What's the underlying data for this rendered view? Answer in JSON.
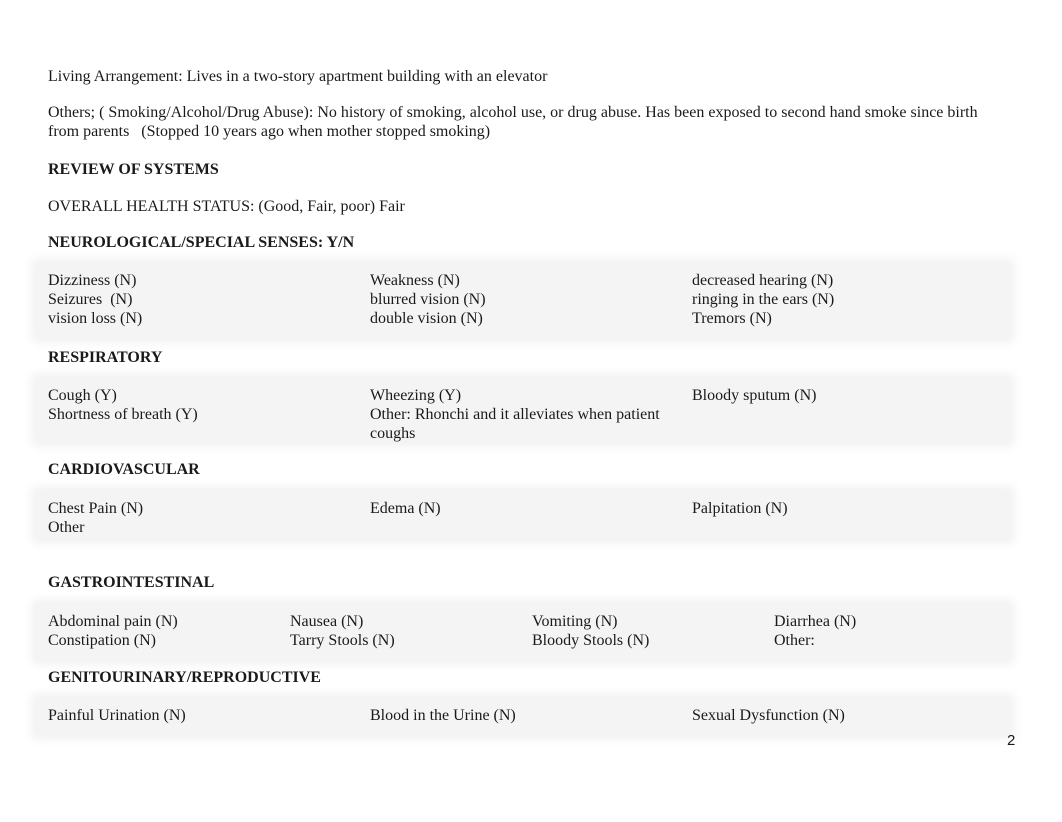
{
  "living_arrangement": "Living Arrangement: Lives in a two-story apartment building with an elevator",
  "others_line1": "Others; ( Smoking/Alcohol/Drug Abuse): No history of smoking, alcohol use, or drug abuse. Has been exposed to second hand smoke since birth",
  "others_line2": "from parents   (Stopped 10 years ago when mother stopped smoking)",
  "review_heading": "REVIEW OF SYSTEMS",
  "overall_health": "OVERALL HEALTH STATUS: (Good, Fair, poor) Fair",
  "sections": {
    "neuro": {
      "heading": "NEUROLOGICAL/SPECIAL SENSES: Y/N",
      "columns": [
        [
          "Dizziness (N)",
          "Seizures  (N)",
          "vision loss (N)"
        ],
        [
          "Weakness (N)",
          "blurred vision (N)",
          "double vision (N)"
        ],
        [
          "decreased hearing (N)",
          "ringing in the ears (N)",
          "Tremors (N)"
        ]
      ]
    },
    "resp": {
      "heading": "RESPIRATORY",
      "columns": [
        [
          "Cough (Y)",
          "Shortness of breath (Y)"
        ],
        [
          "Wheezing (Y)",
          "Other: Rhonchi and it alleviates when patient coughs"
        ],
        [
          "Bloody sputum (N)"
        ]
      ]
    },
    "cardio": {
      "heading": "CARDIOVASCULAR",
      "columns": [
        [
          "Chest Pain (N)",
          "Other"
        ],
        [
          "Edema (N)"
        ],
        [
          "Palpitation (N)"
        ]
      ]
    },
    "gi": {
      "heading": "GASTROINTESTINAL",
      "columns": [
        [
          "Abdominal pain (N)",
          "Constipation (N)"
        ],
        [
          "Nausea (N)",
          "Tarry Stools (N)"
        ],
        [
          "Vomiting (N)",
          "Bloody Stools (N)"
        ],
        [
          "Diarrhea (N)",
          "Other:"
        ]
      ]
    },
    "gu": {
      "heading": "GENITOURINARY/REPRODUCTIVE",
      "columns": [
        [
          "Painful Urination (N)"
        ],
        [
          "Blood in the Urine (N)"
        ],
        [
          "Sexual Dysfunction (N)"
        ]
      ]
    }
  },
  "page_number": "2"
}
